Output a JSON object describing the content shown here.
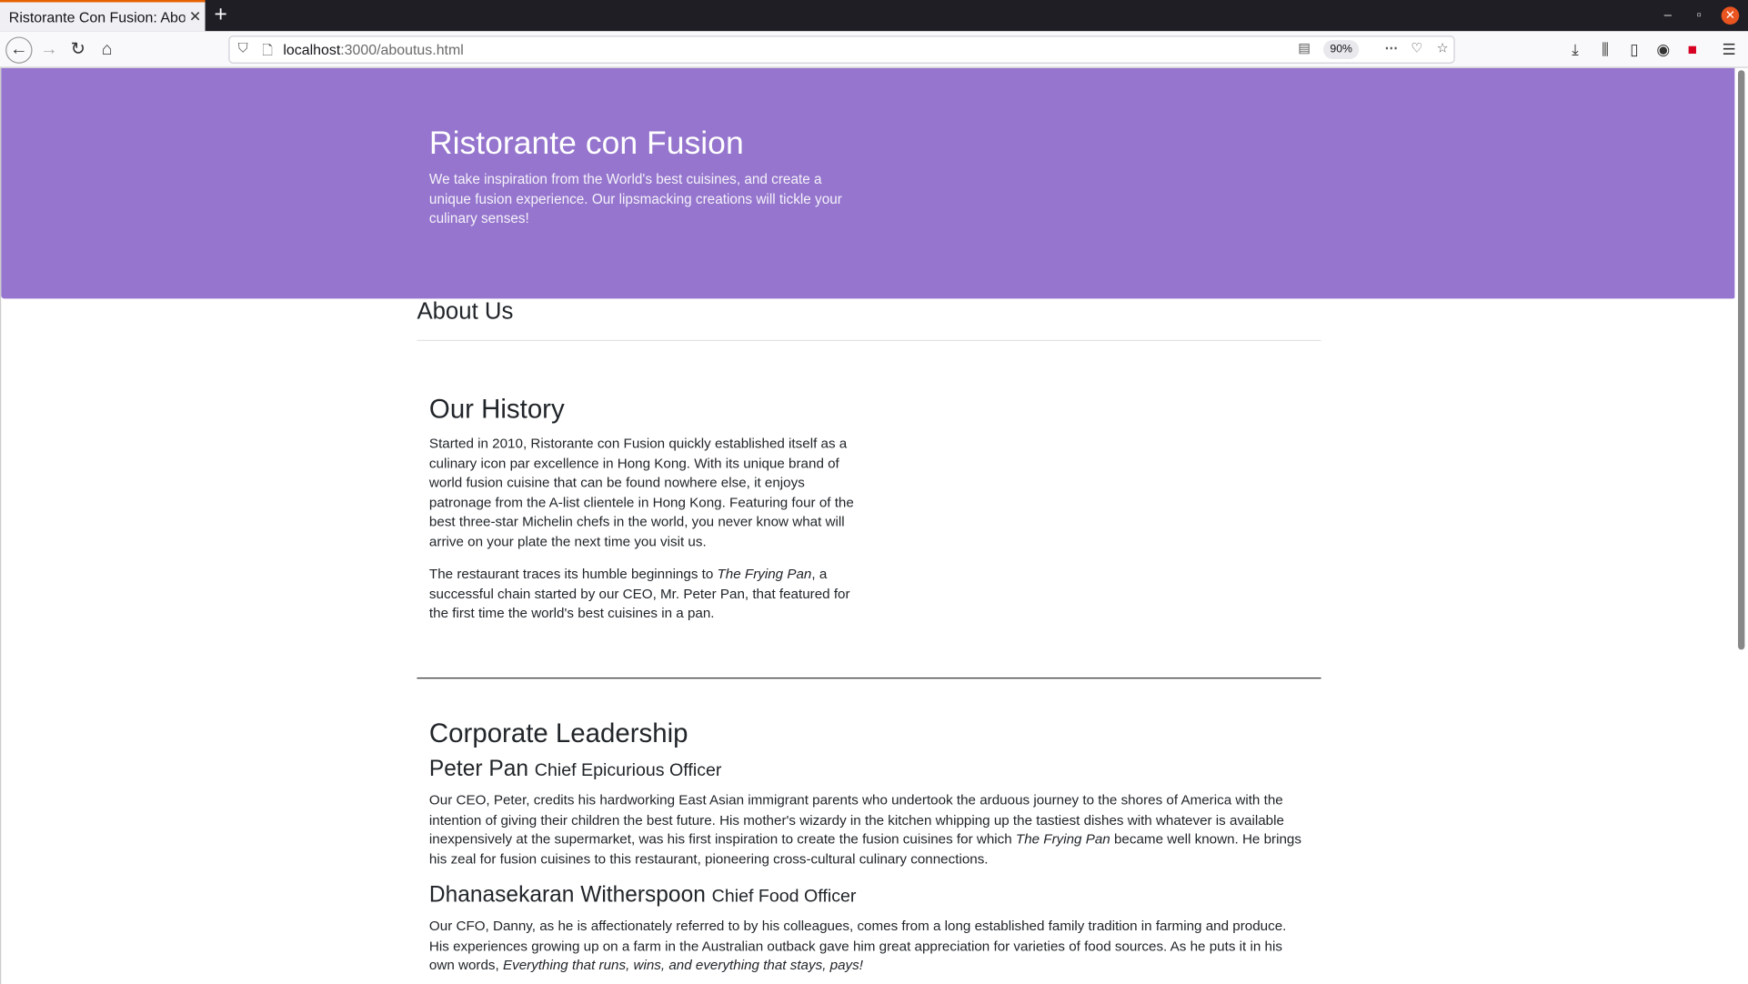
{
  "browser": {
    "tab_title": "Ristorante Con Fusion: About Us",
    "url_host": "localhost",
    "url_path": ":3000/aboutus.html",
    "zoom": "90%"
  },
  "jumbotron": {
    "title": "Ristorante con Fusion",
    "tagline": "We take inspiration from the World's best cuisines, and create a unique fusion experience. Our lipsmacking creations will tickle your culinary senses!"
  },
  "page": {
    "heading": "About Us"
  },
  "history": {
    "heading": "Our History",
    "paragraph1": "Started in 2010, Ristorante con Fusion quickly established itself as a culinary icon par excellence in Hong Kong. With its unique brand of world fusion cuisine that can be found nowhere else, it enjoys patronage from the A-list clientele in Hong Kong. Featuring four of the best three-star Michelin chefs in the world, you never know what will arrive on your plate the next time you visit us.",
    "paragraph2_before": "The restaurant traces its humble beginnings to ",
    "paragraph2_italic": "The Frying Pan",
    "paragraph2_after": ", a successful chain started by our CEO, Mr. Peter Pan, that featured for the first time the world's best cuisines in a pan."
  },
  "leadership": {
    "heading": "Corporate Leadership",
    "people": [
      {
        "name": "Peter Pan",
        "role": "Chief Epicurious Officer",
        "bio_before": "Our CEO, Peter, credits his hardworking East Asian immigrant parents who undertook the arduous journey to the shores of America with the intention of giving their children the best future. His mother's wizardy in the kitchen whipping up the tastiest dishes with whatever is available inexpensively at the supermarket, was his first inspiration to create the fusion cuisines for which ",
        "bio_italic": "The Frying Pan",
        "bio_after": " became well known. He brings his zeal for fusion cuisines to this restaurant, pioneering cross-cultural culinary connections."
      },
      {
        "name": "Dhanasekaran Witherspoon",
        "role": "Chief Food Officer",
        "bio_before": "Our CFO, Danny, as he is affectionately referred to by his colleagues, comes from a long established family tradition in farming and produce. His experiences growing up on a farm in the Australian outback gave him great appreciation for varieties of food sources. As he puts it in his own words, ",
        "bio_italic": "Everything that runs, wins, and everything that stays, pays!",
        "bio_after": ""
      }
    ]
  },
  "colors": {
    "jumbotron_bg": "#9575cd",
    "tab_accent": "#e66000"
  }
}
